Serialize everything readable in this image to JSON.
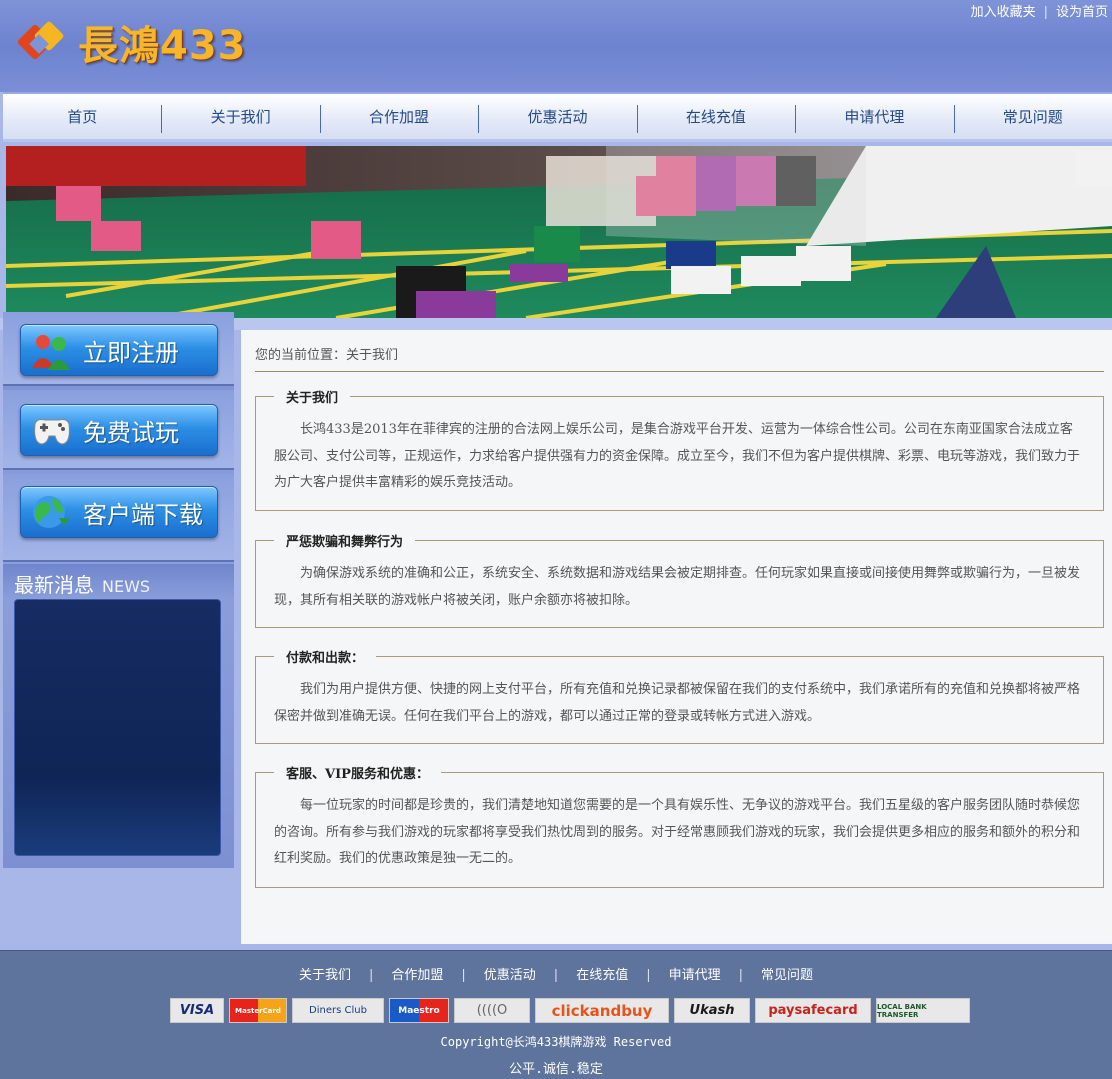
{
  "header": {
    "logo_text": "長鴻433",
    "top_links": [
      "加入收藏夹",
      "设为首页"
    ]
  },
  "nav": {
    "items": [
      "首页",
      "关于我们",
      "合作加盟",
      "优惠活动",
      "在线充值",
      "申请代理",
      "常见问题"
    ]
  },
  "sidebar": {
    "buttons": [
      "立即注册",
      "免费试玩",
      "客户端下载"
    ],
    "news_title": "最新消息",
    "news_title_en": "NEWS"
  },
  "main": {
    "breadcrumb": "您的当前位置：关于我们",
    "sections": [
      {
        "title": "关于我们",
        "body": "长鸿433是2013年在菲律宾的注册的合法网上娱乐公司，是集合游戏平台开发、运营为一体综合性公司。公司在东南亚国家合法成立客服公司、支付公司等，正规运作，力求给客户提供强有力的资金保障。成立至今，我们不但为客户提供棋牌、彩票、电玩等游戏，我们致力于为广大客户提供丰富精彩的娱乐竞技活动。"
      },
      {
        "title": "严惩欺骗和舞弊行为",
        "body": "为确保游戏系统的准确和公正，系统安全、系统数据和游戏结果会被定期排查。任何玩家如果直接或间接使用舞弊或欺骗行为，一旦被发现，其所有相关联的游戏帐户将被关闭，账户余额亦将被扣除。"
      },
      {
        "title": "付款和出款：",
        "body": "我们为用户提供方便、快捷的网上支付平台，所有充值和兑换记录都被保留在我们的支付系统中，我们承诺所有的充值和兑换都将被严格保密并做到准确无误。任何在我们平台上的游戏，都可以通过正常的登录或转帐方式进入游戏。"
      },
      {
        "title": "客服、VIP服务和优惠：",
        "body": "每一位玩家的时间都是珍贵的，我们清楚地知道您需要的是一个具有娱乐性、无争议的游戏平台。我们五星级的客户服务团队随时恭候您的咨询。所有参与我们游戏的玩家都将享受我们热忱周到的服务。对于经常惠顾我们游戏的玩家，我们会提供更多相应的服务和额外的积分和红利奖励。我们的优惠政策是独一无二的。"
      }
    ]
  },
  "footer": {
    "links": [
      "关于我们",
      "合作加盟",
      "优惠活动",
      "在线充值",
      "申请代理",
      "常见问题"
    ],
    "payments": [
      "VISA",
      "MasterCard",
      "Diners Club",
      "Maestro",
      "((((O",
      "clickandbuy",
      "Ukash",
      "paysafecard",
      "LOCAL BANK TRANSFER"
    ],
    "copyright": "Copyright@长鸿433棋牌游戏 Reserved",
    "slogan": "公平.诚信.稳定"
  },
  "colors": {
    "header_bg": "#7f93d8",
    "nav_text": "#234a8a",
    "footer_bg": "#5f749c",
    "logo_gold": "#f7b52a"
  }
}
